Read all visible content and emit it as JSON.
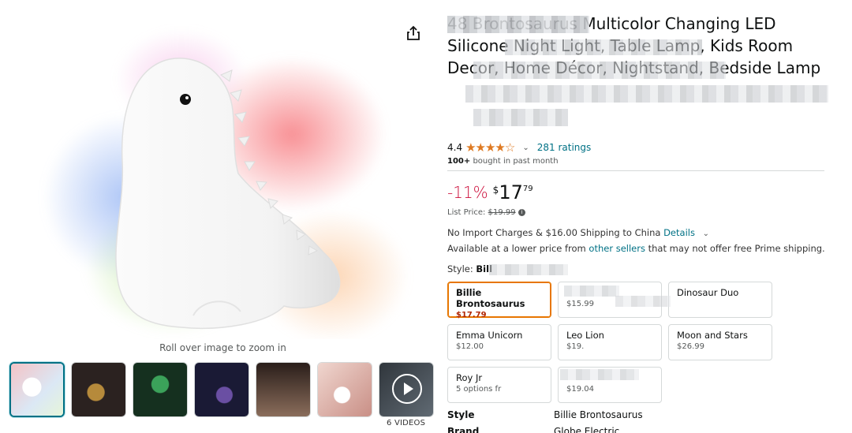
{
  "gallery": {
    "zoom_hint": "Roll over image to zoom in",
    "video_label": "6 VIDEOS",
    "thumbnails": [
      {
        "name": "thumb-1",
        "colors": [
          "#f4d3d6",
          "#dbe8f5"
        ]
      },
      {
        "name": "thumb-2",
        "colors": [
          "#2b2220",
          "#b68a3b"
        ]
      },
      {
        "name": "thumb-3",
        "colors": [
          "#15301f",
          "#3ba25a"
        ]
      },
      {
        "name": "thumb-4",
        "colors": [
          "#1a1a35",
          "#6a4fa3"
        ]
      },
      {
        "name": "thumb-5",
        "colors": [
          "#2a1e1a",
          "#8a6d5b"
        ]
      },
      {
        "name": "thumb-6",
        "colors": [
          "#f0d6cf",
          "#c98f86"
        ]
      },
      {
        "name": "thumb-video",
        "colors": [
          "#30363c",
          "#606a73"
        ]
      }
    ]
  },
  "product": {
    "title": "48 Brontosaurus Multicolor Changing LED Silicone Night Light, Table Lamp, Kids Room Decor, Home Décor, Nightstand, Bedside Lamp",
    "rating": "4.4",
    "stars": "★★★★☆",
    "ratings_count": "281 ratings",
    "bought_bold": "100+",
    "bought_rest": " bought in past month",
    "discount": "-11%",
    "currency": "$",
    "price_whole": "17",
    "price_fraction": "79",
    "list_price_label": "List Price: ",
    "list_price": "$19.99",
    "shipping_text": "No Import Charges & $16.00 Shipping to China ",
    "shipping_link": "Details",
    "available_prefix": "Available at a lower price from ",
    "available_link": "other sellers",
    "available_suffix": " that may not offer free Prime shipping.",
    "style_label": "Style: ",
    "style_value": "Bill"
  },
  "style_options": [
    {
      "name": "Billie Brontosaurus",
      "price": "$17.79",
      "selected": true
    },
    {
      "name": "",
      "price": "$15.99"
    },
    {
      "name": "Dinosaur Duo",
      "price": ""
    },
    {
      "name": "Emma Unicorn",
      "price": "$12.00"
    },
    {
      "name": "Leo Lion",
      "price": "$19."
    },
    {
      "name": "Moon and Stars",
      "price": "$26.99"
    },
    {
      "name": "Roy Jr",
      "price": "5 options fr"
    },
    {
      "name": "",
      "price": "$19.04"
    }
  ],
  "specs": [
    {
      "key": "Style",
      "value": "Billie Brontosaurus"
    },
    {
      "key": "Brand",
      "value": "Globe Electric"
    }
  ],
  "colors": {
    "link": "#007185",
    "star": "#de7921",
    "discount": "#cc0c39",
    "selected_border": "#e77600",
    "deal_price": "#b12704"
  }
}
